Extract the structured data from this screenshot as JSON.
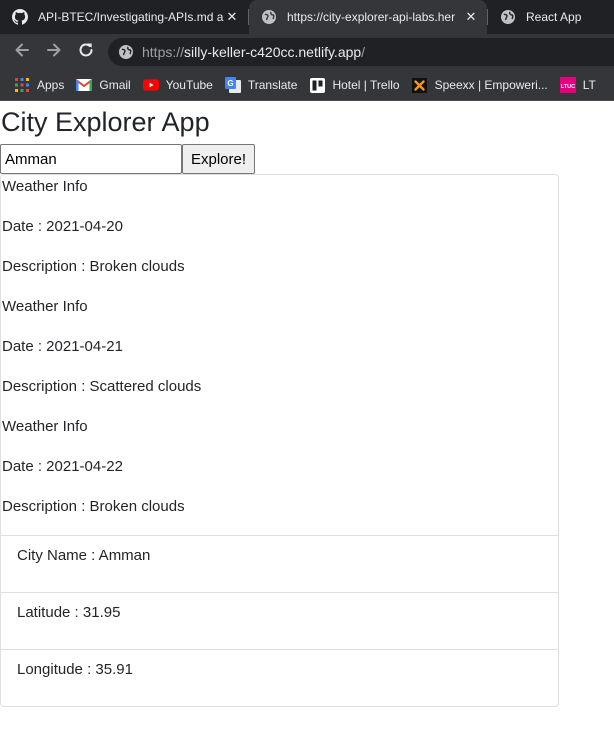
{
  "browser": {
    "tabs": [
      {
        "title": "API-BTEC/Investigating-APIs.md a",
        "icon": "github-icon",
        "active": false
      },
      {
        "title": "https://city-explorer-api-labs.her",
        "icon": "globe-icon",
        "active": true
      },
      {
        "title": "React App",
        "icon": "globe-icon",
        "active": false
      }
    ],
    "tab_close_glyph": "✕",
    "address_bar": {
      "scheme": "https://",
      "host": "silly-keller-c420cc.netlify.app",
      "path": "/"
    },
    "bookmarks": [
      {
        "label": "Apps",
        "icon": "apps-grid-icon"
      },
      {
        "label": "Gmail",
        "icon": "gmail-icon"
      },
      {
        "label": "YouTube",
        "icon": "youtube-icon"
      },
      {
        "label": "Translate",
        "icon": "translate-icon"
      },
      {
        "label": "Hotel | Trello",
        "icon": "trello-icon"
      },
      {
        "label": "Speexx | Empoweri...",
        "icon": "speexx-icon"
      },
      {
        "label": "LT",
        "icon": "ltuc-icon",
        "icon_text": "LTUC"
      }
    ],
    "colors": {
      "tabstrip": "#202124",
      "toolbar": "#35363a",
      "text": "#e8eaed"
    }
  },
  "page": {
    "title": "City Explorer App",
    "search": {
      "value": "Amman",
      "button_label": "Explore!"
    },
    "weather": [
      {
        "heading": "Weather Info",
        "date": "Date : 2021-04-20",
        "description": "Description : Broken clouds"
      },
      {
        "heading": "Weather Info",
        "date": "Date : 2021-04-21",
        "description": "Description : Scattered clouds"
      },
      {
        "heading": "Weather Info",
        "date": "Date : 2021-04-22",
        "description": "Description : Broken clouds"
      }
    ],
    "city": {
      "name": "City Name : Amman",
      "latitude": "Latitude : 31.95",
      "longitude": "Longitude : 35.91"
    }
  }
}
